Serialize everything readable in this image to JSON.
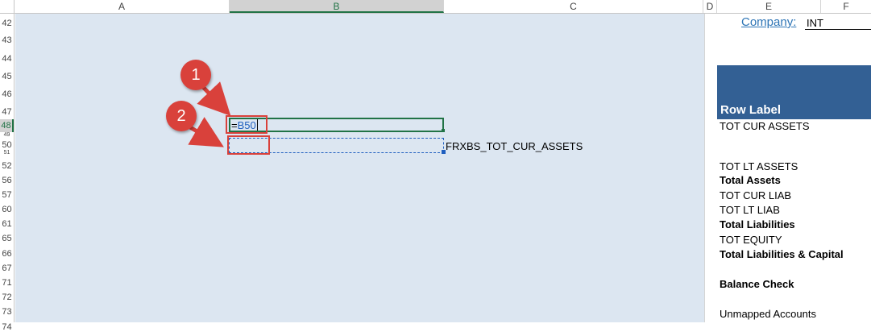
{
  "columns": [
    "A",
    "B",
    "C",
    "D",
    "E",
    "F"
  ],
  "active_column": "B",
  "rows": [
    "42",
    "43",
    "44",
    "45",
    "46",
    "47",
    "48",
    "49",
    "50",
    "51",
    "52",
    "56",
    "57",
    "60",
    "61",
    "65",
    "66",
    "67",
    "71",
    "72",
    "73",
    "74"
  ],
  "active_row": "48",
  "cells": {
    "b48_formula_prefix": "=",
    "b48_formula_ref": "B50",
    "b50_value": "FRXBS_TOT_CUR_ASSETS"
  },
  "annotations": {
    "badge1": "1",
    "badge2": "2"
  },
  "panel": {
    "company_label": "Company:",
    "company_value": "INT",
    "row_label_header": "Row Label",
    "items": [
      {
        "text": "TOT CUR ASSETS",
        "bold": false
      },
      {
        "text": "TOT LT ASSETS",
        "bold": false
      },
      {
        "text": "Total Assets",
        "bold": true
      },
      {
        "text": "TOT CUR LIAB",
        "bold": false
      },
      {
        "text": "TOT LT LIAB",
        "bold": false
      },
      {
        "text": "Total Liabilities",
        "bold": true
      },
      {
        "text": "TOT EQUITY",
        "bold": false
      },
      {
        "text": "Total Liabilities & Capital",
        "bold": true
      },
      {
        "text": "Balance Check",
        "bold": true
      },
      {
        "text": "Unmapped Accounts",
        "bold": false
      }
    ]
  },
  "colors": {
    "sheet_fill": "#dce6f1",
    "selection_green": "#217346",
    "annotation_red": "#d9413b",
    "header_blue": "#336094",
    "link_blue": "#2e75b6"
  }
}
